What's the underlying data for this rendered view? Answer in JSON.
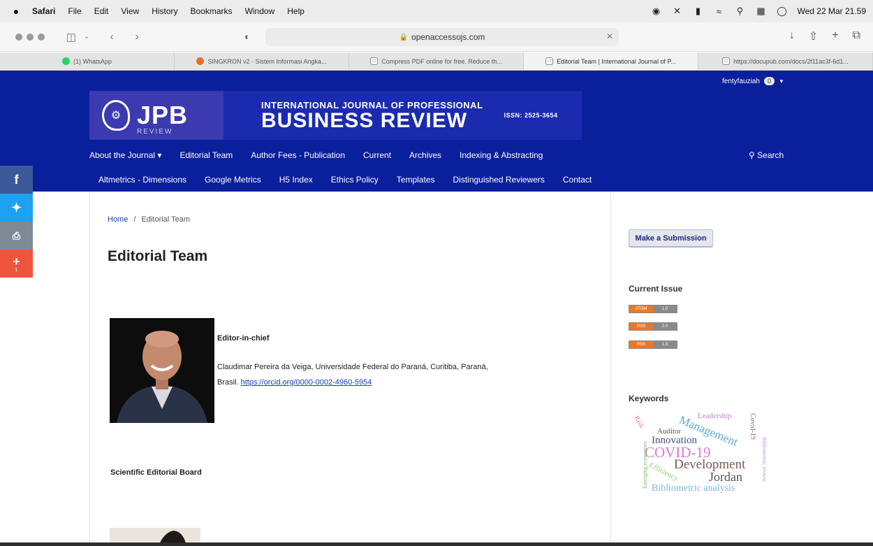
{
  "menubar": {
    "app_name": "Safari",
    "items": [
      "File",
      "Edit",
      "View",
      "History",
      "Bookmarks",
      "Window",
      "Help"
    ],
    "clock": "Wed 22 Mar 21.59"
  },
  "browser": {
    "url": "openaccessojs.com",
    "tabs": [
      {
        "label": "(1) WhatsApp",
        "icon": "whatsapp-icon"
      },
      {
        "label": "SINGKRON v2 - Sistem Informasi Angka...",
        "icon": "singkron-icon"
      },
      {
        "label": "Compress PDF online for free. Reduce th...",
        "icon": "page-icon"
      },
      {
        "label": "Editorial Team | International Journal of P...",
        "icon": "page-icon",
        "active": true
      },
      {
        "label": "https://docupub.com/docs/2f11ac3f-6d1...",
        "icon": "page-icon"
      }
    ]
  },
  "header": {
    "user": "fentyfauziah",
    "notification_count": "0",
    "logo_text": "JPB",
    "logo_sub": "REVIEW",
    "title_line1": "INTERNATIONAL JOURNAL OF PROFESSIONAL",
    "title_line2": "BUSINESS REVIEW",
    "issn": "ISSN: 2525-3654",
    "search_label": "Search"
  },
  "nav": {
    "row1": [
      "About the Journal ▾",
      "Editorial Team",
      "Author Fees - Publication",
      "Current",
      "Archives",
      "Indexing & Abstracting"
    ],
    "row2": [
      "Altmetrics - Dimensions",
      "Google Metrics",
      "H5 Index",
      "Ethics Policy",
      "Templates",
      "Distinguished Reviewers",
      "Contact"
    ]
  },
  "share": {
    "plus_count": "1"
  },
  "content": {
    "breadcrumb_home": "Home",
    "breadcrumb_sep": "/",
    "breadcrumb_current": "Editorial Team",
    "page_title": "Editorial Team",
    "editor_role": "Editor-in-chief",
    "editor_line1": "Claudimar Pereira da Veiga, Universidade Federal do Paraná, Curitiba, Paraná,",
    "editor_line2_prefix": "Brasil.",
    "editor_orcid": "https://orcid.org/0000-0002-4960-5954",
    "board_title": "Scientific Editorial Board"
  },
  "sidebar": {
    "submit_label": "Make a Submission",
    "current_issue_title": "Current Issue",
    "feeds": [
      {
        "left": "ATOM",
        "right": "1.0"
      },
      {
        "left": "RSS",
        "right": "2.0"
      },
      {
        "left": "RSS",
        "right": "1.0"
      }
    ],
    "keywords_title": "Keywords",
    "keywords": [
      {
        "word": "Risk",
        "color": "#e07bb0"
      },
      {
        "word": "Auditor",
        "color": "#555555"
      },
      {
        "word": "Management",
        "color": "#5aa9d6"
      },
      {
        "word": "Leadership",
        "color": "#c27bd0"
      },
      {
        "word": "Covid-19",
        "color": "#777777"
      },
      {
        "word": "Innovation",
        "color": "#444f8f"
      },
      {
        "word": "COVID-19",
        "color": "#d97ad4"
      },
      {
        "word": "Emerging economies",
        "color": "#7ab86a"
      },
      {
        "word": "Efficiency",
        "color": "#8ccf78"
      },
      {
        "word": "Development",
        "color": "#7a5a55"
      },
      {
        "word": "Jordan",
        "color": "#555555"
      },
      {
        "word": "Bibliometric review",
        "color": "#c29ad6"
      },
      {
        "word": "Bibliometric analysis",
        "color": "#78b8df"
      }
    ]
  }
}
